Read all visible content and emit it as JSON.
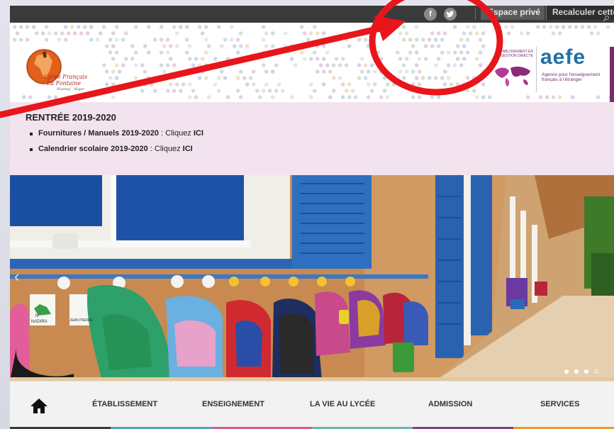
{
  "topbar": {
    "facebook_label": "f",
    "twitter_label": "t",
    "private_space": "Espace privé",
    "search_text": "Recalculer cette"
  },
  "header": {
    "logo_text_line1": "Lycée Français",
    "logo_text_line2": "La Fontaine",
    "logo_text_line3": "Niamey - Niger",
    "aefe_small": "Établissement en gestion directe",
    "aefe_word": "aefe",
    "aefe_sub": "Agence pour l'enseignement français à l'étranger"
  },
  "announce": {
    "title": "RENTRÉE 2019-2020",
    "items": [
      {
        "bold": "Fournitures / Manuels 2019-2020",
        "text": " : Cliquez ",
        "link": "ICI"
      },
      {
        "bold": "Calendrier scolaire 2019-2020",
        "text": " : Cliquez ",
        "link": "ICI"
      }
    ]
  },
  "hero": {
    "prev_label": "‹",
    "label_nadira": "NADIRA",
    "label_jean": "JEAN PIERRE",
    "label_n": "N"
  },
  "nav": {
    "items": [
      {
        "label": "ÉTABLISSEMENT"
      },
      {
        "label": "ENSEIGNEMENT"
      },
      {
        "label": "LA VIE AU LYCÉE"
      },
      {
        "label": "ADMISSION"
      },
      {
        "label": "SERVICES"
      }
    ],
    "colors": [
      "#3a3a3a",
      "#4aa6c8",
      "#d85a8f",
      "#6bb8a8",
      "#8a3b8f",
      "#e89a2a"
    ]
  },
  "colors": {
    "annotation_red": "#e8151b",
    "aefe_blue": "#1f6fa8",
    "aefe_purple": "#7a2c6e"
  }
}
